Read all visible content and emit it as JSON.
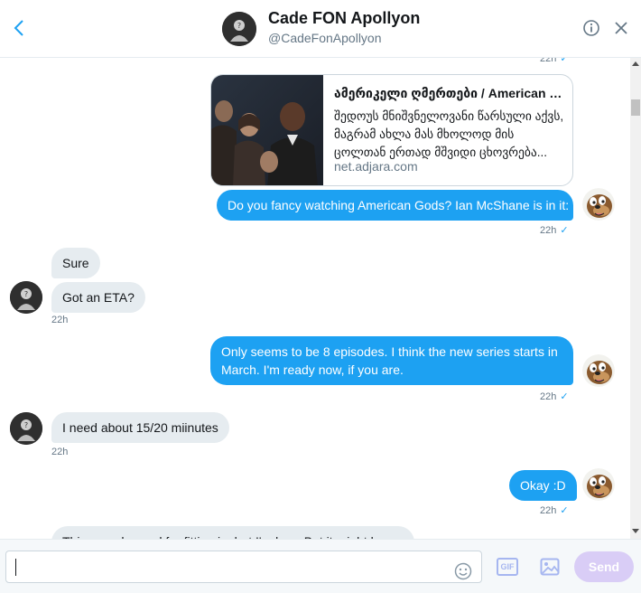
{
  "header": {
    "name": "Cade FON Apollyon",
    "handle": "@CadeFonApollyon"
  },
  "card": {
    "title": "ამერიკელი ღმერთები / American G...",
    "description": "შედოუს მნიშვნელოვანი წარსული აქვს, მაგრამ ახლა მას მხოლოდ მის ცოლთან ერთად მშვიდი ცხოვრება...",
    "domain": "net.adjara.com"
  },
  "messages": [
    {
      "id": "m0",
      "direction": "out",
      "time": "22h",
      "seen": true
    },
    {
      "id": "m1",
      "direction": "out",
      "text": "Do you fancy watching American Gods? Ian McShane is in it:",
      "time": "22h",
      "seen": true
    },
    {
      "id": "m2",
      "direction": "in",
      "text": "Sure"
    },
    {
      "id": "m3",
      "direction": "in",
      "text": "Got an ETA?",
      "time": "22h"
    },
    {
      "id": "m4",
      "direction": "out",
      "text": "Only seems to be 8 episodes. I think the new series starts in March. I'm ready now, if you are.",
      "time": "22h",
      "seen": true
    },
    {
      "id": "m5",
      "direction": "in",
      "text": "I need about 15/20 miinutes",
      "time": "22h"
    },
    {
      "id": "m6",
      "direction": "out",
      "text": "Okay :D",
      "time": "22h",
      "seen": true
    },
    {
      "id": "m7",
      "direction": "in",
      "text": "This sounds good for fitting in, but I'm lazy. But it might be..."
    }
  ],
  "composer": {
    "placeholder": "",
    "gif_label": "GIF",
    "send_label": "Send"
  },
  "colors": {
    "accent": "#1da1f2",
    "incoming_bubble": "#e6ecf0",
    "send_disabled": "#d9cdf6"
  },
  "icons": [
    "back-arrow-icon",
    "info-icon",
    "close-icon",
    "emoji-icon",
    "gif-icon",
    "image-icon",
    "check-icon"
  ]
}
